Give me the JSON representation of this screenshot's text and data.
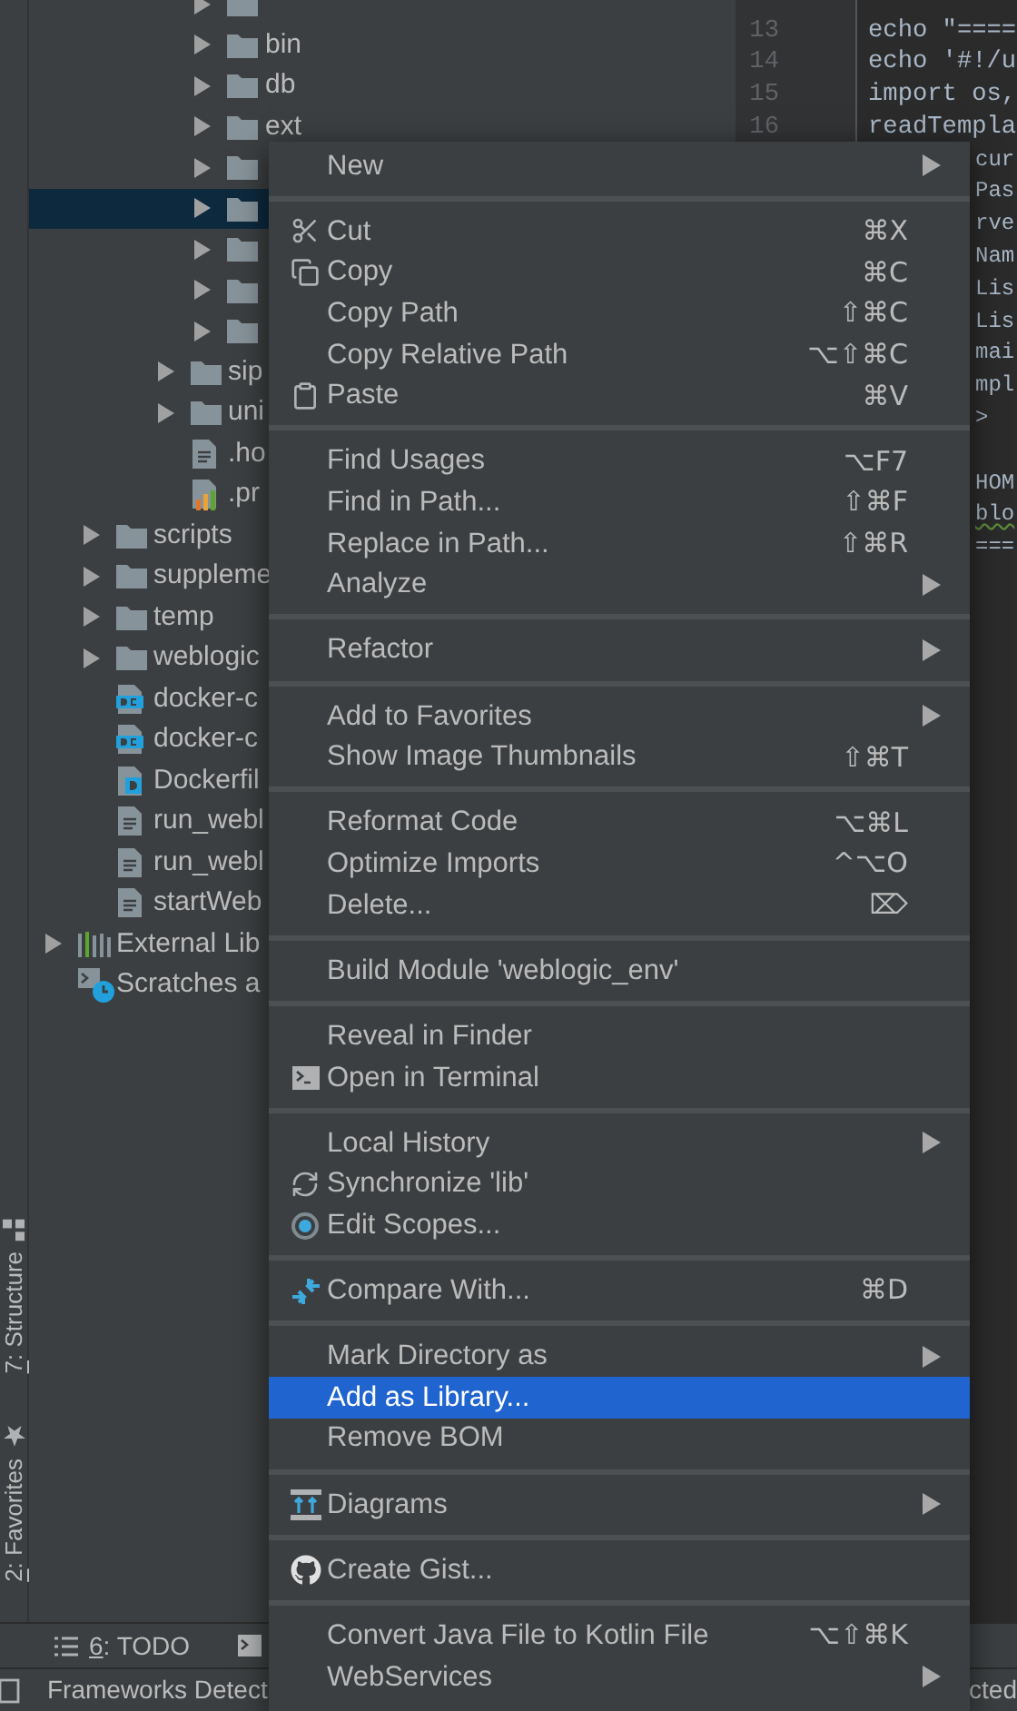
{
  "tool_strip": [
    {
      "mnemonic": "7",
      "text": ": Structure",
      "kind": "structure"
    },
    {
      "mnemonic": "2",
      "text": ": Favorites",
      "kind": "favorites"
    }
  ],
  "tree": {
    "items": [
      {
        "kind": "group",
        "children": [
          {
            "kind": "group",
            "children": [
              {
                "kind": "group",
                "children": [
                  {
                    "kind": "group",
                    "children": [
                      {
                        "kind": "folder",
                        "selected": false
                      },
                      {
                        "kind": "folder",
                        "label": "bin",
                        "selected": false
                      },
                      {
                        "kind": "folder",
                        "label": "db",
                        "selected": false
                      },
                      {
                        "kind": "folder",
                        "label": "ext",
                        "selected": false
                      },
                      {
                        "kind": "folder",
                        "selected": false
                      },
                      {
                        "kind": "folder",
                        "selected": true
                      },
                      {
                        "kind": "folder",
                        "selected": false
                      },
                      {
                        "kind": "folder",
                        "selected": false
                      },
                      {
                        "kind": "folder",
                        "selected": false
                      }
                    ]
                  },
                  {
                    "kind": "folder",
                    "label": "sip",
                    "selected": false
                  },
                  {
                    "kind": "folder",
                    "label": "uni",
                    "selected": false
                  },
                  {
                    "kind": "text-file",
                    "label": ".ho",
                    "selected": false
                  },
                  {
                    "kind": "chart-file",
                    "label": ".pr",
                    "selected": false
                  }
                ]
              }
            ]
          },
          {
            "kind": "folder",
            "label": "scripts",
            "selected": false
          },
          {
            "kind": "folder",
            "label": "suppleme",
            "selected": false
          },
          {
            "kind": "folder",
            "label": "temp",
            "selected": false
          },
          {
            "kind": "folder",
            "label": "weblogic",
            "selected": false
          },
          {
            "kind": "compose-file",
            "label": "docker-c",
            "selected": false
          },
          {
            "kind": "compose-file",
            "label": "docker-c",
            "selected": false
          },
          {
            "kind": "docker-file",
            "label": "Dockerfil",
            "selected": false
          },
          {
            "kind": "text-file",
            "label": "run_webl",
            "selected": false
          },
          {
            "kind": "text-file",
            "label": "run_webl",
            "selected": false
          },
          {
            "kind": "text-file",
            "label": "startWeb",
            "selected": false
          }
        ]
      },
      {
        "kind": "library",
        "label": "External Lib",
        "selected": false
      },
      {
        "kind": "scratches",
        "label": "Scratches a",
        "selected": false
      }
    ]
  },
  "editor": {
    "lines": [
      {
        "kind": "blank"
      },
      {
        "kind": "numbered",
        "number": "13",
        "text": "echo \"===="
      },
      {
        "kind": "numbered",
        "number": "14",
        "text": "echo '#!/u"
      },
      {
        "kind": "numbered",
        "number": "15",
        "text": "import os,"
      },
      {
        "kind": "numbered",
        "number": "16",
        "text": "readTempla"
      },
      {
        "kind": "tail",
        "text": "cur"
      },
      {
        "kind": "tail",
        "text": "Pas"
      },
      {
        "kind": "tail",
        "text": "rve"
      },
      {
        "kind": "tail",
        "text": "Nam"
      },
      {
        "kind": "tail",
        "text": "Lis"
      },
      {
        "kind": "tail",
        "text": "Lis"
      },
      {
        "kind": "tail",
        "text": "mai"
      },
      {
        "kind": "tail",
        "text": "mpl"
      },
      {
        "kind": "tail",
        "text": ">"
      },
      {
        "kind": "blank"
      },
      {
        "kind": "tail",
        "text": "HOM"
      },
      {
        "kind": "tail",
        "text": "blo",
        "warning": true
      },
      {
        "kind": "tail",
        "text": "==="
      }
    ]
  },
  "bottom_bar": {
    "todo": {
      "mnemonic": "6",
      "text": ": TODO"
    }
  },
  "status_bar": {
    "left": "Frameworks Detect",
    "right": "cted"
  },
  "context_menu": {
    "groups": [
      {
        "items": [
          {
            "label": "New",
            "kind": "plain",
            "submenu": true,
            "selected": false
          }
        ]
      },
      {
        "items": [
          {
            "label": "Cut",
            "kind": "cut",
            "shortcut": "⌘X",
            "submenu": false,
            "selected": false
          },
          {
            "label": "Copy",
            "kind": "copy",
            "shortcut": "⌘C",
            "submenu": false,
            "selected": false
          },
          {
            "label": "Copy Path",
            "kind": "plain",
            "shortcut": "⇧⌘C",
            "submenu": false,
            "selected": false
          },
          {
            "label": "Copy Relative Path",
            "kind": "plain",
            "shortcut": "⌥⇧⌘C",
            "submenu": false,
            "selected": false
          },
          {
            "label": "Paste",
            "kind": "paste",
            "shortcut": "⌘V",
            "submenu": false,
            "selected": false
          }
        ]
      },
      {
        "items": [
          {
            "label": "Find Usages",
            "kind": "plain",
            "shortcut": "⌥F7",
            "submenu": false,
            "selected": false
          },
          {
            "label": "Find in Path...",
            "kind": "plain",
            "shortcut": "⇧⌘F",
            "submenu": false,
            "selected": false
          },
          {
            "label": "Replace in Path...",
            "kind": "plain",
            "shortcut": "⇧⌘R",
            "submenu": false,
            "selected": false
          },
          {
            "label": "Analyze",
            "kind": "plain",
            "submenu": true,
            "selected": false
          }
        ]
      },
      {
        "items": [
          {
            "label": "Refactor",
            "kind": "plain",
            "submenu": true,
            "selected": false
          }
        ]
      },
      {
        "items": [
          {
            "label": "Add to Favorites",
            "kind": "plain",
            "submenu": true,
            "selected": false
          },
          {
            "label": "Show Image Thumbnails",
            "kind": "plain",
            "shortcut": "⇧⌘T",
            "submenu": false,
            "selected": false
          }
        ]
      },
      {
        "items": [
          {
            "label": "Reformat Code",
            "kind": "plain",
            "shortcut": "⌥⌘L",
            "submenu": false,
            "selected": false
          },
          {
            "label": "Optimize Imports",
            "kind": "plain",
            "shortcut": "^⌥O",
            "submenu": false,
            "selected": false
          },
          {
            "label": "Delete...",
            "kind": "plain",
            "shortcut": "⌦",
            "submenu": false,
            "selected": false
          }
        ]
      },
      {
        "items": [
          {
            "label": "Build Module 'weblogic_env'",
            "kind": "plain",
            "submenu": false,
            "selected": false
          }
        ]
      },
      {
        "items": [
          {
            "label": "Reveal in Finder",
            "kind": "plain",
            "submenu": false,
            "selected": false
          },
          {
            "label": "Open in Terminal",
            "kind": "terminal",
            "submenu": false,
            "selected": false
          }
        ]
      },
      {
        "items": [
          {
            "label": "Local History",
            "kind": "plain",
            "submenu": true,
            "selected": false
          },
          {
            "label": "Synchronize 'lib'",
            "kind": "sync",
            "submenu": false,
            "selected": false
          },
          {
            "label": "Edit Scopes...",
            "kind": "scopes",
            "submenu": false,
            "selected": false
          }
        ]
      },
      {
        "items": [
          {
            "label": "Compare With...",
            "kind": "compare",
            "shortcut": "⌘D",
            "submenu": false,
            "selected": false
          }
        ]
      },
      {
        "items": [
          {
            "label": "Mark Directory as",
            "kind": "plain",
            "submenu": true,
            "selected": false
          },
          {
            "label": "Add as Library...",
            "kind": "plain",
            "submenu": false,
            "selected": true
          },
          {
            "label": "Remove BOM",
            "kind": "plain",
            "submenu": false,
            "selected": false
          }
        ]
      },
      {
        "items": [
          {
            "label": "Diagrams",
            "kind": "diagrams",
            "submenu": true,
            "selected": false
          }
        ]
      },
      {
        "items": [
          {
            "label": "Create Gist...",
            "kind": "gist",
            "submenu": false,
            "selected": false
          }
        ]
      },
      {
        "items": [
          {
            "label": "Convert Java File to Kotlin File",
            "kind": "plain",
            "shortcut": "⌥⇧⌘K",
            "submenu": false,
            "selected": false
          },
          {
            "label": "WebServices",
            "kind": "plain",
            "submenu": true,
            "selected": false
          }
        ]
      }
    ]
  }
}
